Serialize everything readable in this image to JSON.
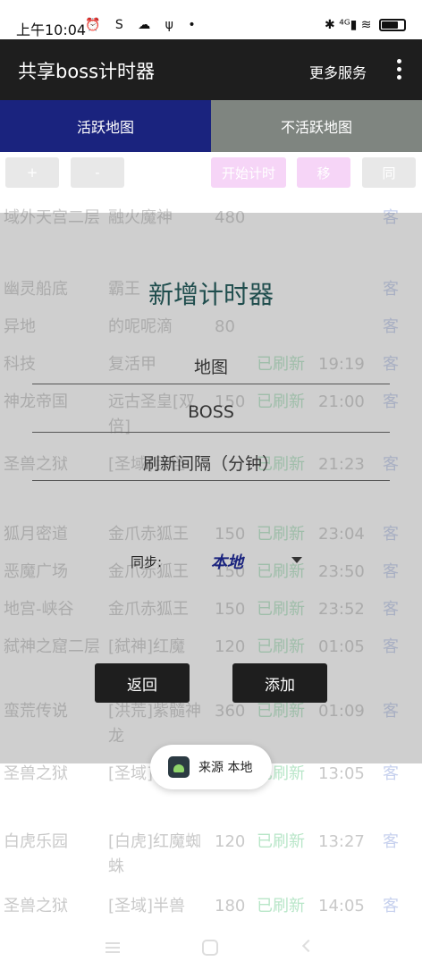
{
  "status_bar": {
    "time": "上午10:04",
    "left_icons": "⏰ S ☁ ψ •",
    "right_icons": "✱ ⁴ᴳ▮ ≋",
    "battery_level": 0.75
  },
  "app_bar": {
    "title": "共享boss计时器",
    "more_label": "更多服务"
  },
  "tabs": [
    {
      "label": "活跃地图"
    },
    {
      "label": "不活跃地图"
    }
  ],
  "toolbar": {
    "add": "+",
    "minus": "-",
    "start": "开始计时",
    "move": "移",
    "sync": "同"
  },
  "rows": [
    {
      "map": "域外天宫二层",
      "boss": "融火魔神",
      "interval": "480",
      "status": "",
      "time": "",
      "source": "客"
    },
    {
      "map": "幽灵船底",
      "boss": "霸王",
      "interval": "",
      "status": "",
      "time": "",
      "source": "客"
    },
    {
      "map": "异地",
      "boss": "的呢呢滴",
      "interval": "80",
      "status": "",
      "time": "",
      "source": "客"
    },
    {
      "map": "科技",
      "boss": "复活甲",
      "interval": "",
      "status": "已刷新",
      "time": "19:19",
      "source": "客"
    },
    {
      "map": "神龙帝国",
      "boss": "远古圣皇[双倍]",
      "interval": "150",
      "status": "已刷新",
      "time": "21:00",
      "source": "客"
    },
    {
      "map": "圣兽之狱",
      "boss": "[圣域]巨怪",
      "interval": "",
      "status": "已刷新",
      "time": "21:23",
      "source": "客"
    },
    {
      "map": "狐月密道",
      "boss": "金爪赤狐王",
      "interval": "150",
      "status": "已刷新",
      "time": "23:04",
      "source": "客"
    },
    {
      "map": "恶魔广场",
      "boss": "金爪赤狐王",
      "interval": "150",
      "status": "已刷新",
      "time": "23:50",
      "source": "客"
    },
    {
      "map": "地宫-峡谷",
      "boss": "金爪赤狐王",
      "interval": "150",
      "status": "已刷新",
      "time": "23:52",
      "source": "客"
    },
    {
      "map": "弑神之窟二层",
      "boss": "[弑神]红魔",
      "interval": "120",
      "status": "已刷新",
      "time": "01:05",
      "source": "客"
    },
    {
      "map": "蛮荒传说",
      "boss": "[洪荒]紫髓神龙",
      "interval": "360",
      "status": "已刷新",
      "time": "01:09",
      "source": "客"
    },
    {
      "map": "圣兽之狱",
      "boss": "[圣域]守护神",
      "interval": "",
      "status": "已刷新",
      "time": "13:05",
      "source": "客"
    },
    {
      "map": "白虎乐园",
      "boss": "[白虎]红魔蜘蛛",
      "interval": "120",
      "status": "已刷新",
      "time": "13:27",
      "source": "客"
    },
    {
      "map": "圣兽之狱",
      "boss": "[圣域]半兽",
      "interval": "180",
      "status": "已刷新",
      "time": "14:05",
      "source": "客"
    }
  ],
  "dialog": {
    "title": "新增计时器",
    "map_placeholder": "地图",
    "boss_placeholder": "BOSS",
    "interval_placeholder": "刷新间隔（分钟）",
    "sync_label": "同步:",
    "sync_value": "本地",
    "back_label": "返回",
    "add_label": "添加"
  },
  "toast": {
    "text": "来源 本地"
  },
  "colors": {
    "app_bar": "#1e1e1e",
    "tab_active": "#1a237e",
    "tab_inactive": "#7f8580",
    "status_refreshed": "#b8e6c8"
  }
}
